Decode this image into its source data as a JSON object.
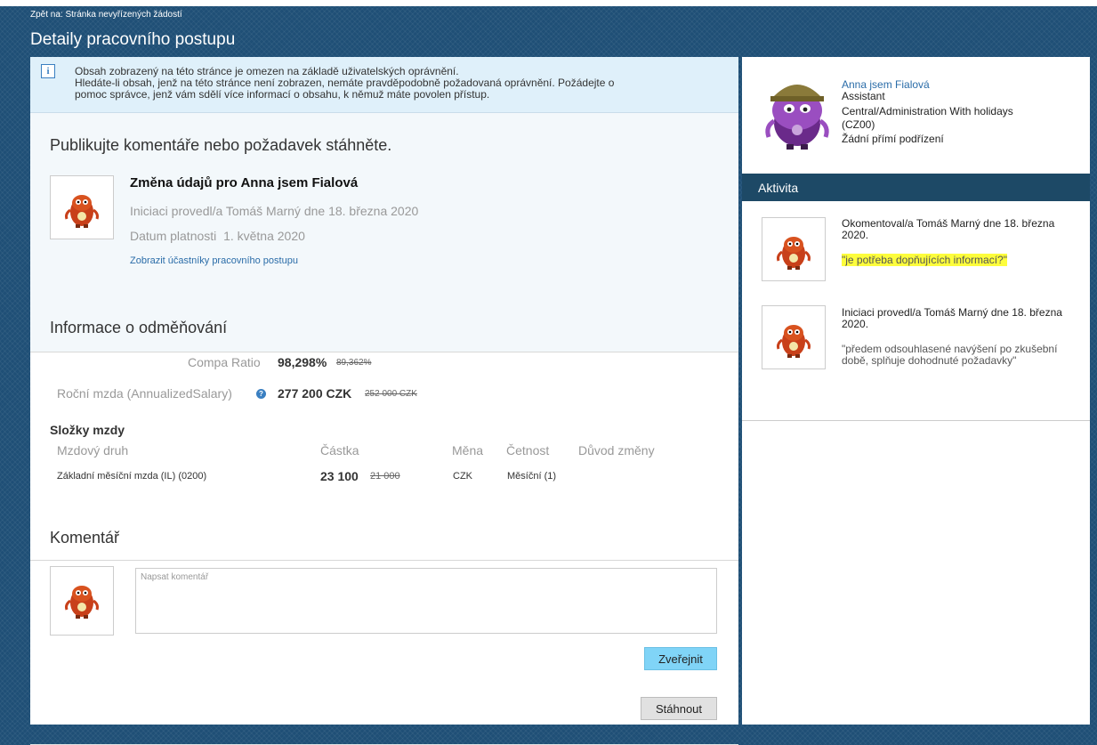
{
  "header": {
    "back_link": "Zpět na: Stránka nevyřízených žádostí",
    "title": "Detaily pracovního postupu"
  },
  "info_banner": {
    "icon": "info-icon",
    "lines": [
      "Obsah zobrazený na této stránce je omezen na základě uživatelských oprávnění.",
      "Hledáte-li obsah, jenž na této stránce není zobrazen, nemáte pravděpodobně požadovaná oprávnění. Požádejte o",
      "pomoc správce, jenž vám sdělí více informací o obsahu, k němuž máte povolen přístup."
    ]
  },
  "publish": {
    "title": "Publikujte komentáře nebo požadavek stáhněte.",
    "request_title": "Změna údajů pro Anna jsem Fialová",
    "initiated": "Iniciaci provedl/a Tomáš Marný dne 18. března 2020",
    "effective_label": "Datum platnosti",
    "effective_value": "1. května 2020",
    "participants_link": "Zobrazit účastníky pracovního postupu"
  },
  "compensation": {
    "title": "Informace o odměňování",
    "compa_label": "Compa Ratio",
    "compa_new": "98,298%",
    "compa_old": "89,362%",
    "salary_label": "Roční mzda (AnnualizedSalary)",
    "salary_new": "277 200 CZK",
    "salary_old": "252 000 CZK",
    "components_title": "Složky mzdy",
    "columns": [
      "Mzdový druh",
      "Částka",
      "Měna",
      "Četnost",
      "Důvod změny"
    ],
    "rows": [
      {
        "type": "Základní měsíční mzda (IL) (0200)",
        "amount_new": "23 100",
        "amount_old": "21 000",
        "currency": "CZK",
        "frequency": "Měsíční (1)",
        "reason": ""
      }
    ]
  },
  "comment": {
    "title": "Komentář",
    "placeholder": "Napsat komentář",
    "publish_button": "Zveřejnit",
    "withdraw_button": "Stáhnout"
  },
  "profile": {
    "name": "Anna jsem Fialová",
    "position": "Assistant",
    "department": "Central/Administration With holidays",
    "code": "(CZ00)",
    "reports": "Žádní přímí podřízení"
  },
  "activity": {
    "title": "Aktivita",
    "items": [
      {
        "text": "Okomentoval/a Tomáš Marný dne 18. března 2020.",
        "quote": "\"je potřeba dopňujících informací?\"",
        "highlighted": true
      },
      {
        "text": "Iniciaci provedl/a Tomáš Marný dne 18. března 2020.",
        "quote": "\"předem odsouhlasené navýšení po zkušební době, splňuje dohodnuté požadavky\"",
        "highlighted": false
      }
    ]
  },
  "colors": {
    "background": "#1f4f76",
    "activity_header": "#1d4966",
    "publish_button": "#80d4f7",
    "highlight": "#fdfd3c",
    "link": "#2a6ca8"
  }
}
